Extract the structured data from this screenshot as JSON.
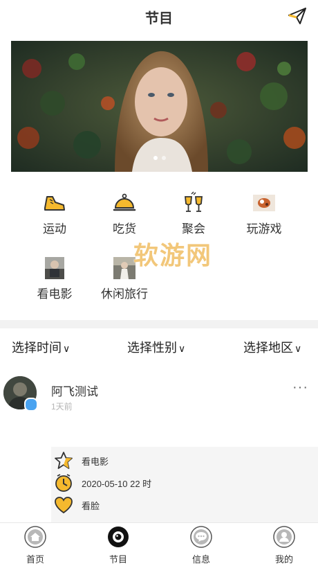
{
  "header": {
    "title": "节目",
    "send_icon": "paper-plane-icon"
  },
  "banner": {
    "page_count": 2,
    "active_index": 0
  },
  "categories": [
    {
      "label": "运动",
      "icon": "sneaker-icon"
    },
    {
      "label": "吃货",
      "icon": "food-cloche-icon"
    },
    {
      "label": "聚会",
      "icon": "wine-glasses-icon"
    },
    {
      "label": "玩游戏",
      "icon": "game-thumbnail-icon"
    },
    {
      "label": "看电影",
      "icon": "movie-thumbnail-icon"
    },
    {
      "label": "休闲旅行",
      "icon": "travel-thumbnail-icon"
    }
  ],
  "watermark": "软游网",
  "filters": [
    {
      "label": "选择时间"
    },
    {
      "label": "选择性别"
    },
    {
      "label": "选择地区"
    }
  ],
  "post": {
    "username": "阿飞测试",
    "time": "1天前",
    "more_label": "···",
    "details": [
      {
        "icon": "star-icon",
        "text": "看电影"
      },
      {
        "icon": "clock-icon",
        "text": "2020-05-10 22 时"
      },
      {
        "icon": "heart-icon",
        "text": "看脸"
      }
    ]
  },
  "tabs": [
    {
      "label": "首页",
      "icon": "home-icon"
    },
    {
      "label": "节目",
      "icon": "program-eye-icon",
      "active": true
    },
    {
      "label": "信息",
      "icon": "message-icon"
    },
    {
      "label": "我的",
      "icon": "profile-icon"
    }
  ],
  "colors": {
    "accent": "#f5b92e",
    "active_tab": "#111111"
  }
}
